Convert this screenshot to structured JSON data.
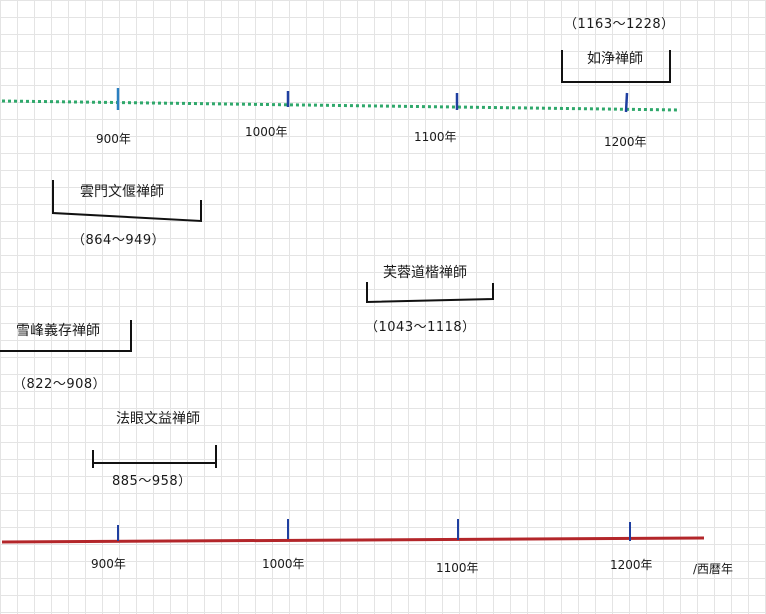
{
  "top_timeline": {
    "ticks": [
      "900年",
      "1000年",
      "1100年",
      "1200年"
    ],
    "line_color": "#2fa86b"
  },
  "bottom_timeline": {
    "ticks": [
      "900年",
      "1000年",
      "1100年",
      "1200年"
    ],
    "axis_unit": "/西暦年",
    "line_color": "#b3262a"
  },
  "tick_mark_color": "#1f3fa0",
  "masters": [
    {
      "name": "如浄禅師",
      "dates": "（1163～1228）"
    },
    {
      "name": "雲門文偃禅師",
      "dates": "（864～949）"
    },
    {
      "name": "芙蓉道楷禅師",
      "dates": "（1043～1118）"
    },
    {
      "name": "雪峰義存禅師",
      "dates": "（822～908）"
    },
    {
      "name": "法眼文益禅師",
      "dates": "885～958）"
    }
  ]
}
